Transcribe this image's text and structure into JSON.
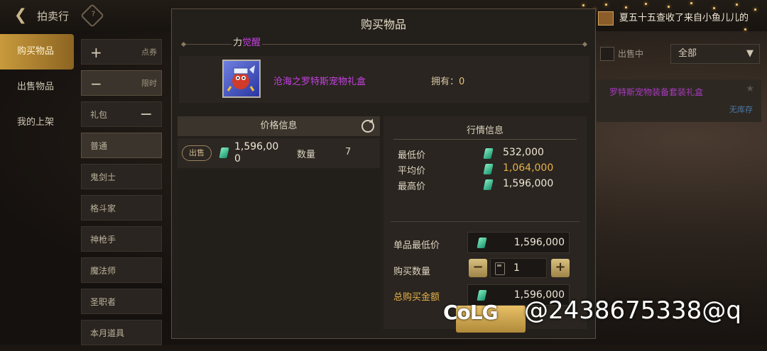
{
  "topbar": {
    "title": "拍卖行",
    "back_icon": "arrow-left-icon",
    "help_icon": "diamond-icon"
  },
  "nav": {
    "items": [
      {
        "label": "购买物品",
        "active": true
      },
      {
        "label": "出售物品",
        "active": false
      },
      {
        "label": "我的上架",
        "active": false
      }
    ]
  },
  "categories": {
    "add_label": "点券",
    "minus_label": "限时",
    "items": [
      "礼包",
      "普通",
      "鬼剑士",
      "格斗家",
      "神枪手",
      "魔法师",
      "圣职者",
      "本月道具"
    ]
  },
  "background_panel": {
    "filter_label": "出售中",
    "select_value": "全部",
    "item_name": "罗特斯宠物装备套装礼盒",
    "item_stock": "无库存"
  },
  "notice": {
    "text": "夏五十五查收了来自小鱼儿儿的"
  },
  "modal": {
    "title": "购买物品",
    "awaken_prefix": "力",
    "awaken_label": "觉醒",
    "item_name": "沧海之罗特斯宠物礼盒",
    "own_label": "拥有：",
    "own_value": "0",
    "price_info": {
      "header": "价格信息",
      "sell_button": "出售",
      "price": "1,596,000",
      "qty_label": "数量",
      "qty_value": "7"
    },
    "market_info": {
      "header": "行情信息",
      "stats": [
        {
          "label": "最低价",
          "value": "532,000"
        },
        {
          "label": "平均价",
          "value": "1,064,000"
        },
        {
          "label": "最高价",
          "value": "1,596,000"
        }
      ],
      "unit_min_label": "单品最低价",
      "unit_min_value": "1,596,000",
      "buy_qty_label": "购买数量",
      "buy_qty_value": "1",
      "total_label": "总购买金额",
      "total_value": "1,596,000"
    }
  },
  "watermark": {
    "logo": "CoLG",
    "text": "@2438675338@q"
  },
  "colors": {
    "accent_gold": "#e6b24a",
    "item_purple": "#c441e0",
    "gem": "#3fd1a0"
  }
}
